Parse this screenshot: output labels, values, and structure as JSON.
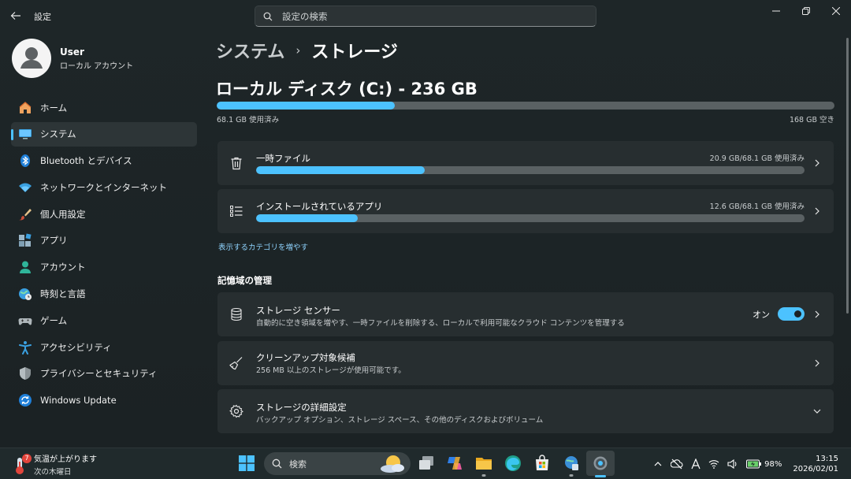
{
  "window": {
    "app_title": "設定",
    "search_placeholder": "設定の検索"
  },
  "profile": {
    "name": "User",
    "account_type": "ローカル アカウント"
  },
  "sidebar": {
    "items": [
      {
        "label": "ホーム",
        "icon": "home-icon"
      },
      {
        "label": "システム",
        "icon": "system-icon",
        "active": true
      },
      {
        "label": "Bluetooth とデバイス",
        "icon": "bluetooth-icon"
      },
      {
        "label": "ネットワークとインターネット",
        "icon": "network-icon"
      },
      {
        "label": "個人用設定",
        "icon": "brush-icon"
      },
      {
        "label": "アプリ",
        "icon": "apps-icon"
      },
      {
        "label": "アカウント",
        "icon": "account-icon"
      },
      {
        "label": "時刻と言語",
        "icon": "globe-clock-icon"
      },
      {
        "label": "ゲーム",
        "icon": "gamepad-icon"
      },
      {
        "label": "アクセシビリティ",
        "icon": "accessibility-icon"
      },
      {
        "label": "プライバシーとセキュリティ",
        "icon": "shield-icon"
      },
      {
        "label": "Windows Update",
        "icon": "update-icon"
      }
    ]
  },
  "breadcrumb": {
    "parent": "システム",
    "separator": "›",
    "current": "ストレージ"
  },
  "disk": {
    "title": "ローカル ディスク (C:) - 236 GB",
    "used_label": "68.1 GB 使用済み",
    "free_label": "168 GB 空き",
    "used_fraction": 0.288
  },
  "categories": [
    {
      "title": "一時ファイル",
      "meta": "20.9 GB/68.1 GB 使用済み",
      "fraction": 0.307,
      "icon": "trash-icon"
    },
    {
      "title": "インストールされているアプリ",
      "meta": "12.6 GB/68.1 GB 使用済み",
      "fraction": 0.185,
      "icon": "app-list-icon"
    }
  ],
  "more_categories_link": "表示するカテゴリを増やす",
  "management": {
    "section_title": "記憶域の管理",
    "items": [
      {
        "title": "ストレージ センサー",
        "subtitle": "自動的に空き領域を増やす、一時ファイルを削除する、ローカルで利用可能なクラウド コンテンツを管理する",
        "toggle_label": "オン",
        "toggle_on": true,
        "icon": "storage-sense-icon"
      },
      {
        "title": "クリーンアップ対象候補",
        "subtitle": "256 MB 以上のストレージが使用可能です。",
        "icon": "broom-icon"
      },
      {
        "title": "ストレージの詳細設定",
        "subtitle": "バックアップ オプション、ストレージ スペース、その他のディスクおよびボリューム",
        "icon": "gear-icon"
      }
    ]
  },
  "taskbar": {
    "weather_badge": "7",
    "weather_line1": "気温が上がります",
    "weather_line2": "次の木曜日",
    "search_label": "検索",
    "battery": "98%",
    "time": "13:15",
    "date": "2026/02/01"
  },
  "colors": {
    "accent": "#4cc2ff",
    "background": "#1e2628",
    "card": "#272e30"
  }
}
